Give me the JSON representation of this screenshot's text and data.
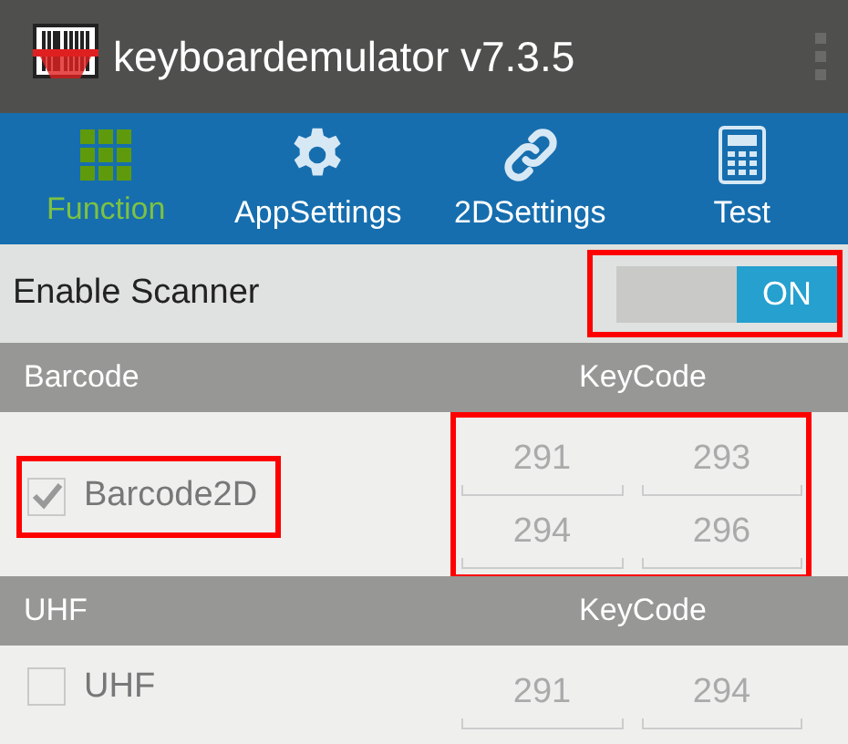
{
  "app_bar": {
    "title": "keyboardemulator v7.3.5"
  },
  "tabs": [
    {
      "label": "Function",
      "kind": "grid",
      "selected": true
    },
    {
      "label": "AppSettings",
      "kind": "gear",
      "selected": false
    },
    {
      "label": "2DSettings",
      "kind": "link",
      "selected": false
    },
    {
      "label": "Test",
      "kind": "calculator",
      "selected": false
    }
  ],
  "enable_scanner": {
    "label": "Enable Scanner",
    "on": true,
    "switch_text": "ON",
    "highlighted": true
  },
  "sections": [
    {
      "header": "Barcode",
      "keycode_header": "KeyCode",
      "item": {
        "label": "Barcode2D",
        "checked": true,
        "highlighted": true
      },
      "codes": [
        "291",
        "293",
        "294",
        "296"
      ],
      "codes_highlighted": true
    },
    {
      "header": "UHF",
      "keycode_header": "KeyCode",
      "item": {
        "label": "UHF",
        "checked": false,
        "highlighted": false
      },
      "codes": [
        "291",
        "294"
      ],
      "codes_highlighted": false
    }
  ]
}
